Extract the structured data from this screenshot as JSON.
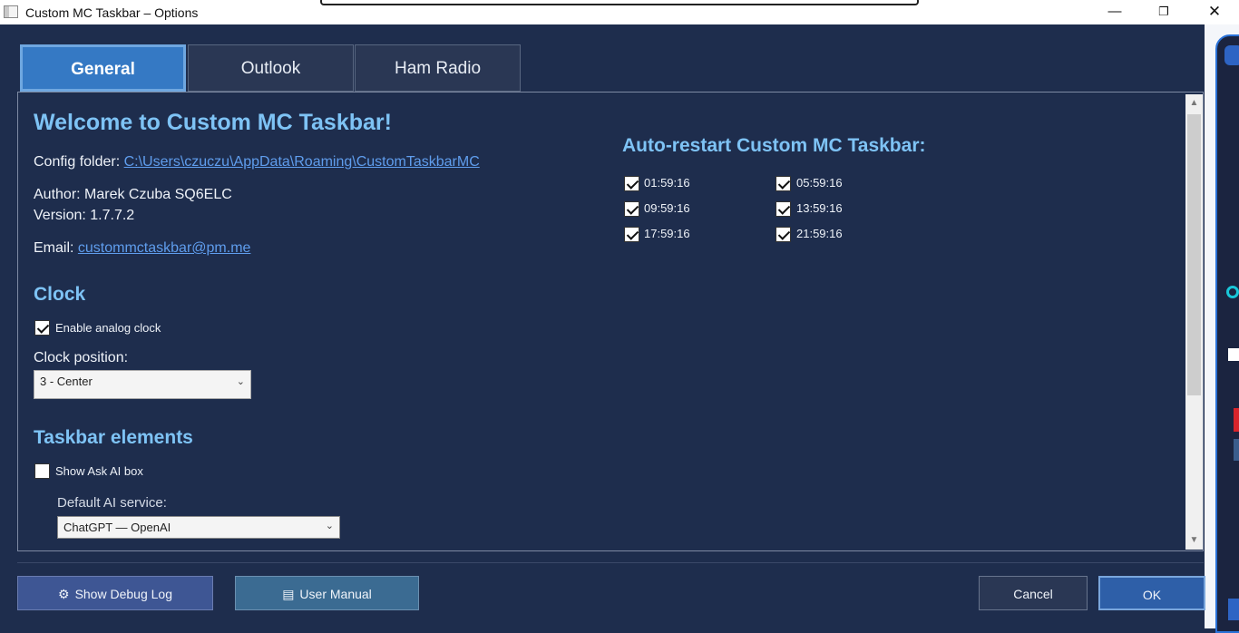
{
  "window": {
    "title": "Custom MC Taskbar – Options",
    "minimize_glyph": "—",
    "maximize_glyph": "❐",
    "close_glyph": "✕"
  },
  "tabs": [
    {
      "label": "General",
      "active": true
    },
    {
      "label": "Outlook",
      "active": false
    },
    {
      "label": "Ham Radio",
      "active": false
    }
  ],
  "general": {
    "welcome_title": "Welcome to Custom MC Taskbar!",
    "config_label": "Config folder: ",
    "config_path": "C:\\Users\\czuczu\\AppData\\Roaming\\CustomTaskbarMC",
    "author_line": "Author: Marek Czuba SQ6ELC",
    "version_line": "Version: 1.7.7.2",
    "email_label": "Email: ",
    "email": "custommctaskbar@pm.me"
  },
  "clock": {
    "heading": "Clock",
    "enable_label": "Enable analog clock",
    "enable_checked": true,
    "position_label": "Clock position:",
    "position_value": "3 - Center"
  },
  "taskbar_elements": {
    "heading": "Taskbar elements",
    "ask_ai_label": "Show Ask AI box",
    "ask_ai_checked": false,
    "ai_service_label": "Default AI service:",
    "ai_service_value": "ChatGPT — OpenAI"
  },
  "auto_restart": {
    "heading": "Auto-restart Custom MC Taskbar:",
    "times": [
      {
        "time": "01:59:16",
        "checked": true
      },
      {
        "time": "05:59:16",
        "checked": true
      },
      {
        "time": "09:59:16",
        "checked": true
      },
      {
        "time": "13:59:16",
        "checked": true
      },
      {
        "time": "17:59:16",
        "checked": true
      },
      {
        "time": "21:59:16",
        "checked": true
      }
    ]
  },
  "buttons": {
    "debug_icon": "⚙",
    "debug_label": "Show Debug Log",
    "manual_icon": "▤",
    "manual_label": "User Manual",
    "cancel_label": "Cancel",
    "ok_label": "OK"
  },
  "scrollbar": {
    "up_glyph": "▲",
    "down_glyph": "▼"
  }
}
